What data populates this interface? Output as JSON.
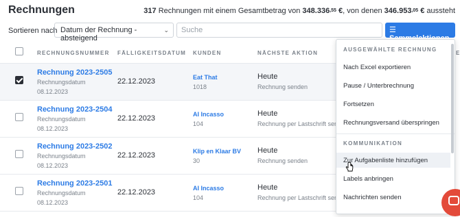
{
  "page": {
    "title": "Rechnungen",
    "summary": {
      "count": "317",
      "text1": " Rechnungen mit einem Gesamtbetrag von ",
      "total_main": "348.336",
      "total_cents": ",55",
      "total_suffix": " €",
      "text2": ", von denen ",
      "open_main": "346.953",
      "open_cents": ",05",
      "open_suffix": " €",
      "text3": " aussteht"
    }
  },
  "toolbar": {
    "sort_label": "Sortieren nach",
    "sort_value": "Datum der Rechnung - absteigend",
    "search_placeholder": "Suche",
    "bulk_label": "Sammelaktionen",
    "bulk_icon": "list-icon"
  },
  "table": {
    "headers": [
      "RECHNUNGSNUMMER",
      "FÄLLIGKEITSDATUM",
      "KUNDEN",
      "NÄCHSTE AKTION"
    ],
    "rows": [
      {
        "checked": true,
        "number": "Rechnung 2023-2505",
        "date_label": "Rechnungsdatum",
        "date": "08.12.2023",
        "due": "22.12.2023",
        "customer": "Eat That",
        "customer_id": "1018",
        "action": "Heute",
        "action_sub": "Rechnung senden"
      },
      {
        "checked": false,
        "number": "Rechnung 2023-2504",
        "date_label": "Rechnungsdatum",
        "date": "08.12.2023",
        "due": "22.12.2023",
        "customer": "AI Incasso",
        "customer_id": "104",
        "action": "Heute",
        "action_sub": "Rechnung per Lastschrift sende"
      },
      {
        "checked": false,
        "number": "Rechnung 2023-2502",
        "date_label": "Rechnungsdatum",
        "date": "08.12.2023",
        "due": "22.12.2023",
        "customer": "Klip en Klaar BV",
        "customer_id": "30",
        "action": "Heute",
        "action_sub": "Rechnung senden"
      },
      {
        "checked": false,
        "number": "Rechnung 2023-2501",
        "date_label": "Rechnungsdatum",
        "date": "08.12.2023",
        "due": "22.12.2023",
        "customer": "AI Incasso",
        "customer_id": "104",
        "action": "Heute",
        "action_sub": "Rechnung per Lastschrift sende"
      }
    ]
  },
  "menu": {
    "section1": "AUSGEWÄHLTE RECHNUNG",
    "items1": [
      "Nach Excel exportieren",
      "Pause / Unterbrechnung",
      "Fortsetzen",
      "Rechnungsversand überspringen"
    ],
    "section2": "KOMMUNIKATION",
    "items2": [
      "Zur Aufgabenliste hinzufügen",
      "Labels anbringen",
      "Nachrichten senden"
    ]
  },
  "colors": {
    "accent": "#2c7be5",
    "chat": "#e34a3a"
  }
}
